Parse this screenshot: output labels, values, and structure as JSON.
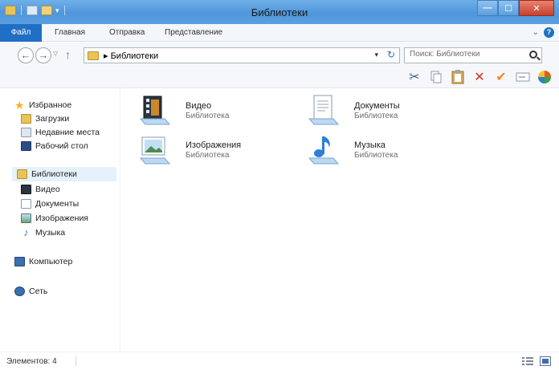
{
  "window": {
    "title": "Библиотеки"
  },
  "ribbon": {
    "tabs": [
      "Файл",
      "Главная",
      "Отправка",
      "Представление"
    ]
  },
  "address": {
    "breadcrumb": "Библиотеки",
    "search_placeholder": "Поиск: Библиотеки"
  },
  "toolbar": {
    "icons": [
      "cut-icon",
      "copy-icon",
      "paste-icon",
      "delete-icon",
      "checkmark-icon",
      "rename-icon",
      "properties-icon"
    ]
  },
  "navigation": {
    "favorites": {
      "label": "Избранное",
      "items": [
        "Загрузки",
        "Недавние места",
        "Рабочий стол"
      ]
    },
    "libraries": {
      "label": "Библиотеки",
      "items": [
        "Видео",
        "Документы",
        "Изображения",
        "Музыка"
      ]
    },
    "computer": "Компьютер",
    "network": "Сеть"
  },
  "content": {
    "items": [
      {
        "name": "Видео",
        "type": "Библиотека",
        "icon": "video-library-icon"
      },
      {
        "name": "Документы",
        "type": "Библиотека",
        "icon": "documents-library-icon"
      },
      {
        "name": "Изображения",
        "type": "Библиотека",
        "icon": "pictures-library-icon"
      },
      {
        "name": "Музыка",
        "type": "Библиотека",
        "icon": "music-library-icon"
      }
    ]
  },
  "status": {
    "count_text": "Элементов: 4"
  },
  "colors": {
    "titlebar": "#5aa0e0",
    "file_tab": "#1f6fc5",
    "selected_nav": "#e5f1fb"
  }
}
